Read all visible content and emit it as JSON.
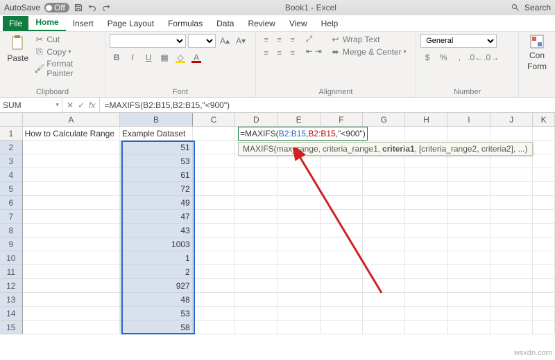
{
  "titlebar": {
    "autosave": "AutoSave",
    "off": "Off",
    "title": "Book1 - Excel",
    "search": "Search"
  },
  "tabs": [
    "File",
    "Home",
    "Insert",
    "Page Layout",
    "Formulas",
    "Data",
    "Review",
    "View",
    "Help"
  ],
  "active_tab": 1,
  "ribbon": {
    "clipboard": {
      "paste": "Paste",
      "cut": "Cut",
      "copy": "Copy",
      "fmt": "Format Painter",
      "label": "Clipboard"
    },
    "font": {
      "name": "",
      "size": "",
      "label": "Font",
      "b": "B",
      "i": "I",
      "u": "U"
    },
    "align": {
      "wrap": "Wrap Text",
      "merge": "Merge & Center",
      "label": "Alignment"
    },
    "number": {
      "fmt": "General",
      "label": "Number",
      "cond": "Con",
      "form": "Form"
    }
  },
  "namebox": "SUM",
  "formula": "=MAXIFS(B2:B15,B2:B15,\"<900\")",
  "formula_parts": {
    "fn": "=MAXIFS(",
    "r1": "B2:B15",
    "c1": ",",
    "r2": "B2:B15",
    "c2": ",",
    "lit": "\"<900\"",
    "end": ")"
  },
  "tooltip": {
    "fn": "MAXIFS(",
    "a1": "max_range",
    "a2": "criteria_range1",
    "a3": "criteria1",
    "a4": "[criteria_range2, criteria2]",
    "tail": ", ...)"
  },
  "cols": [
    "A",
    "B",
    "C",
    "D",
    "E",
    "F",
    "G",
    "H",
    "I",
    "J",
    "K"
  ],
  "rows": [
    "1",
    "2",
    "3",
    "4",
    "5",
    "6",
    "7",
    "8",
    "9",
    "10",
    "11",
    "12",
    "13",
    "14",
    "15"
  ],
  "colA": {
    "1": "How to Calculate Range"
  },
  "colB": {
    "1": "Example Dataset",
    "2": "51",
    "3": "53",
    "4": "61",
    "5": "72",
    "6": "49",
    "7": "47",
    "8": "43",
    "9": "1003",
    "10": "1",
    "11": "2",
    "12": "927",
    "13": "48",
    "14": "53",
    "15": "58"
  },
  "chart_data": {
    "type": "table",
    "title": "Example Dataset",
    "values": [
      51,
      53,
      61,
      72,
      49,
      47,
      43,
      1003,
      1,
      2,
      927,
      48,
      53,
      58
    ],
    "formula": "=MAXIFS(B2:B15,B2:B15,\"<900\")"
  },
  "wm": "wsxdn.com"
}
